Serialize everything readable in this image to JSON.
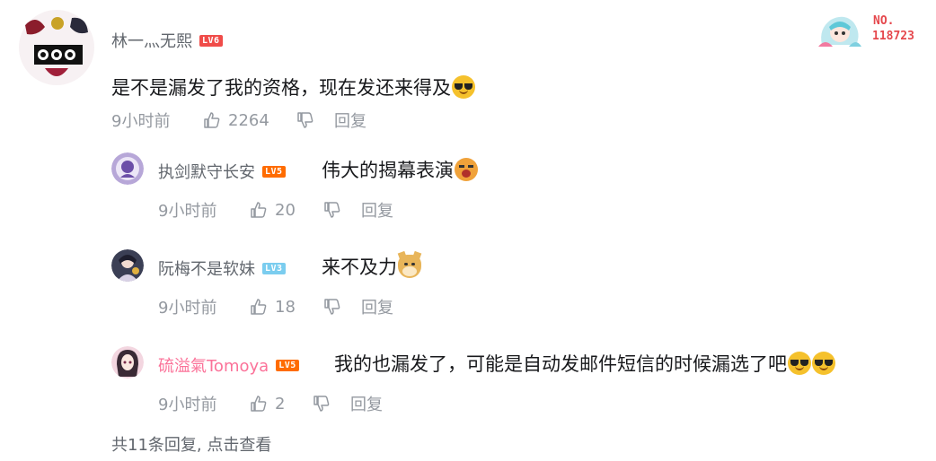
{
  "comment": {
    "username": "林一灬无熙",
    "level": "LV6",
    "text": "是不是漏发了我的资格，现在发还来得及",
    "emoji": "cool-sunglasses-emoji",
    "time": "9小时前",
    "likes": "2264",
    "reply_label": "回复",
    "fan_badge": {
      "prefix": "NO.",
      "number": "118723"
    }
  },
  "replies": [
    {
      "username": "执剑默守长安",
      "level": "LV5",
      "text": "伟大的揭幕表演",
      "emoji": "crying-emoji",
      "time": "9小时前",
      "likes": "20",
      "reply_label": "回复"
    },
    {
      "username": "阮梅不是软妹",
      "level": "LV3",
      "text": "来不及力",
      "emoji": "doge-emoji",
      "time": "9小时前",
      "likes": "18",
      "reply_label": "回复"
    },
    {
      "username": "硫溢氣Tomoya",
      "level": "LV5",
      "text": "我的也漏发了，可能是自动发邮件短信的时候漏选了吧",
      "emoji": "cool-sunglasses-emoji",
      "time": "9小时前",
      "likes": "2",
      "reply_label": "回复"
    }
  ],
  "footer": {
    "more_replies": "共11条回复, 点击查看"
  },
  "colors": {
    "username": "#61666d",
    "vip_username": "#fb7299",
    "meta": "#9499a0",
    "lv6": "#f04c49",
    "lv5": "#ff6c00",
    "lv3": "#7bcdef",
    "fan_number": "#e5484d"
  }
}
